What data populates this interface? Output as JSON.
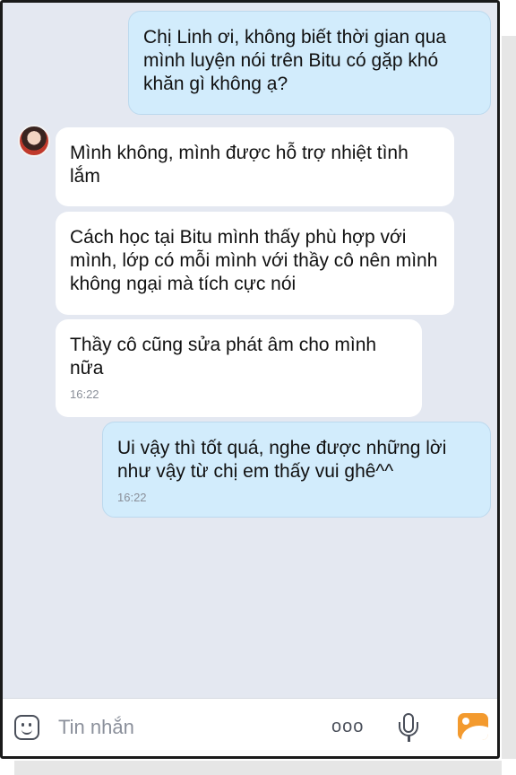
{
  "conversation": {
    "messages": [
      {
        "direction": "outgoing",
        "text": "Chị Linh ơi, không biết thời gian qua mình luyện nói trên Bitu có gặp khó khăn gì không ạ?",
        "time": ""
      },
      {
        "direction": "incoming",
        "text": "Mình không, mình được hỗ trợ nhiệt tình lắm",
        "time": ""
      },
      {
        "direction": "incoming",
        "text": "Cách học tại Bitu mình thấy phù hợp với mình, lớp có mỗi mình với thầy cô nên mình không ngại mà tích cực nói",
        "time": ""
      },
      {
        "direction": "incoming",
        "text": "Thầy cô cũng sửa phát âm cho mình nữa",
        "time": "16:22"
      },
      {
        "direction": "outgoing",
        "text": "Ui vậy thì tốt quá, nghe được những lời như vậy từ chị em thấy vui ghê^^",
        "time": "16:22"
      }
    ]
  },
  "composer": {
    "placeholder": "Tin nhắn",
    "more_label": "ooo",
    "icons": [
      "emoji-icon",
      "more-icon",
      "microphone-icon",
      "photo-icon"
    ]
  },
  "colors": {
    "chat_background": "#e4e8f1",
    "incoming_bubble": "#ffffff",
    "outgoing_bubble": "#d2ecfc",
    "accent_photo": "#f39a2e"
  }
}
